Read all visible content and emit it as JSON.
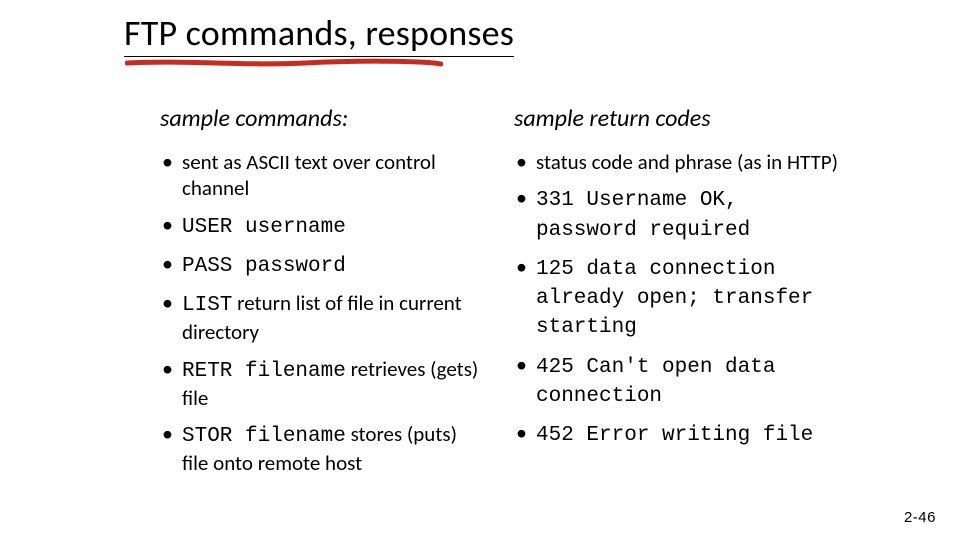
{
  "title": "FTP commands, responses",
  "left": {
    "header": "sample commands:",
    "items": [
      {
        "pre": "",
        "mono": "",
        "post": "sent as ASCII text over control channel"
      },
      {
        "pre": "",
        "mono": "USER username",
        "post": ""
      },
      {
        "pre": "",
        "mono": "PASS password",
        "post": ""
      },
      {
        "pre": "",
        "mono": "LIST",
        "post": " return list of file in current directory"
      },
      {
        "pre": "",
        "mono": "RETR filename",
        "post": " retrieves (gets) file"
      },
      {
        "pre": "",
        "mono": "STOR filename",
        "post": " stores (puts) file onto remote host"
      }
    ]
  },
  "right": {
    "header": "sample return codes",
    "items": [
      {
        "pre": "status code and phrase (as in HTTP)",
        "mono": "",
        "post": ""
      },
      {
        "pre": "",
        "mono": "331 Username OK, password required",
        "post": ""
      },
      {
        "pre": "",
        "mono": "125 data connection already open; transfer starting",
        "post": ""
      },
      {
        "pre": "",
        "mono": "425 Can't open data connection",
        "post": ""
      },
      {
        "pre": "",
        "mono": "452 Error writing file",
        "post": ""
      }
    ]
  },
  "slide_number": "2-46"
}
